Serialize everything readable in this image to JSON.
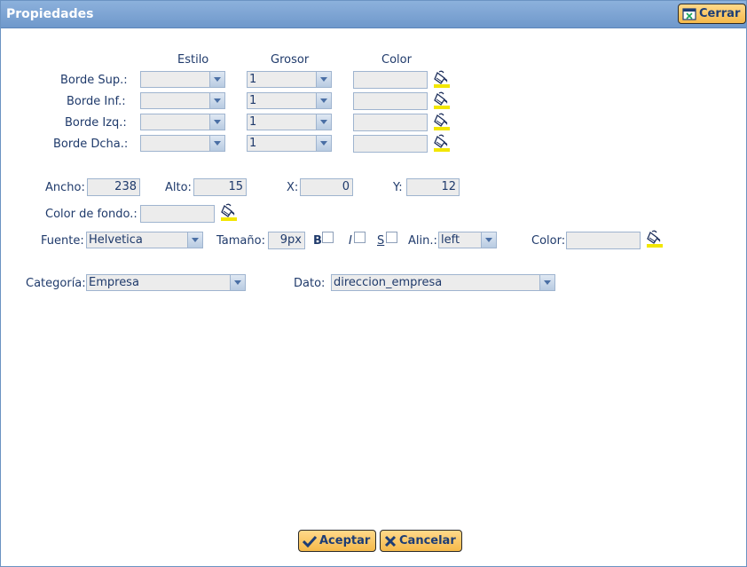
{
  "window": {
    "title": "Propiedades",
    "close_label": "Cerrar"
  },
  "borders": {
    "headers": {
      "style": "Estilo",
      "thickness": "Grosor",
      "color": "Color"
    },
    "rows": [
      {
        "label": "Borde Sup.:",
        "style": "",
        "thickness": "1",
        "color": ""
      },
      {
        "label": "Borde Inf.:",
        "style": "",
        "thickness": "1",
        "color": ""
      },
      {
        "label": "Borde Izq.:",
        "style": "",
        "thickness": "1",
        "color": ""
      },
      {
        "label": "Borde Dcha.:",
        "style": "",
        "thickness": "1",
        "color": ""
      }
    ]
  },
  "geometry": {
    "width_label": "Ancho:",
    "width_value": "238",
    "height_label": "Alto:",
    "height_value": "15",
    "x_label": "X:",
    "x_value": "0",
    "y_label": "Y:",
    "y_value": "12"
  },
  "background": {
    "label": "Color de fondo.:",
    "value": ""
  },
  "font": {
    "family_label": "Fuente:",
    "family_value": "Helvetica",
    "size_label": "Tamaño:",
    "size_value": "9px",
    "bold_label": "B",
    "bold_checked": false,
    "italic_label": "I",
    "italic_checked": false,
    "underline_label": "S",
    "underline_checked": false,
    "align_label": "Alin.:",
    "align_value": "left",
    "color_label": "Color:",
    "color_value": ""
  },
  "data_source": {
    "category_label": "Categoría:",
    "category_value": "Empresa",
    "field_label": "Dato:",
    "field_value": "direccion_empresa"
  },
  "footer": {
    "accept_label": "Aceptar",
    "cancel_label": "Cancelar"
  },
  "colors": {
    "titlebar": "#7aa1d2",
    "button": "#f7c15a",
    "text": "#1f3a6b",
    "input_bg": "#ececec"
  },
  "icons": {
    "close": "window-close-icon",
    "accept": "check-icon",
    "cancel": "x-icon",
    "paint": "paint-bucket-icon"
  }
}
